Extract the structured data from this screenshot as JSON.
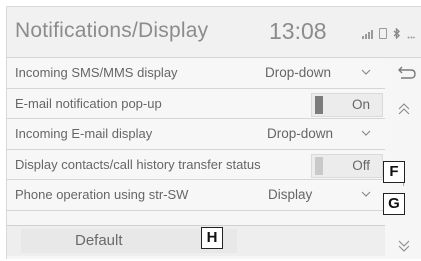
{
  "header": {
    "title": "Notifications/Display",
    "time": "13:08"
  },
  "status_icons": [
    "signal-icon",
    "battery-icon",
    "bluetooth-icon",
    "dots-icon"
  ],
  "bluetooth_glyph": "ʙ",
  "rows": [
    {
      "label": "Incoming SMS/MMS display",
      "control": "dropdown",
      "value": "Drop-down"
    },
    {
      "label": "E-mail notification pop-up",
      "control": "toggle",
      "value": "On"
    },
    {
      "label": "Incoming E-mail display",
      "control": "dropdown",
      "value": "Drop-down"
    },
    {
      "label": "Display contacts/call history transfer status",
      "control": "toggle",
      "value": "Off"
    },
    {
      "label": "Phone operation using str-SW",
      "control": "dropdown",
      "value": "Display"
    }
  ],
  "default_button": {
    "label": "Default"
  },
  "callouts": {
    "f": "F",
    "g": "G",
    "h": "H"
  },
  "colors": {
    "background": "#f6f6f6",
    "text": "#666666",
    "toggle_on": "#7c7c7c"
  }
}
